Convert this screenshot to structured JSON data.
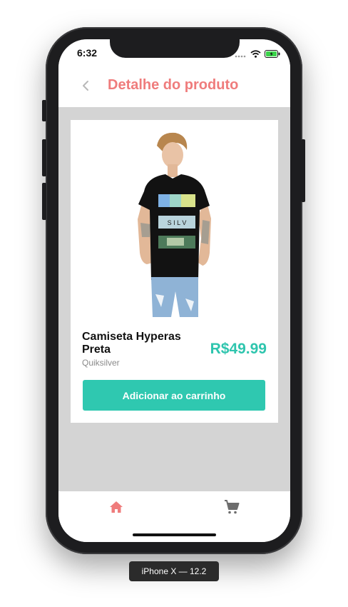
{
  "status_bar": {
    "time": "6:32"
  },
  "header": {
    "title": "Detalhe do produto"
  },
  "product": {
    "name": "Camiseta Hyperas Preta",
    "brand": "Quiksilver",
    "price": "R$49.99",
    "shirt_print": "S I L V",
    "add_to_cart_label": "Adicionar ao carrinho"
  },
  "tabs": [
    {
      "icon": "home-icon",
      "active": true
    },
    {
      "icon": "cart-icon",
      "active": false
    }
  ],
  "device_label": "iPhone X — 12.2",
  "colors": {
    "accent_title": "#ef7c7c",
    "price": "#2fc5ae",
    "button": "#2fc8b0",
    "background": "#d4d4d4"
  }
}
